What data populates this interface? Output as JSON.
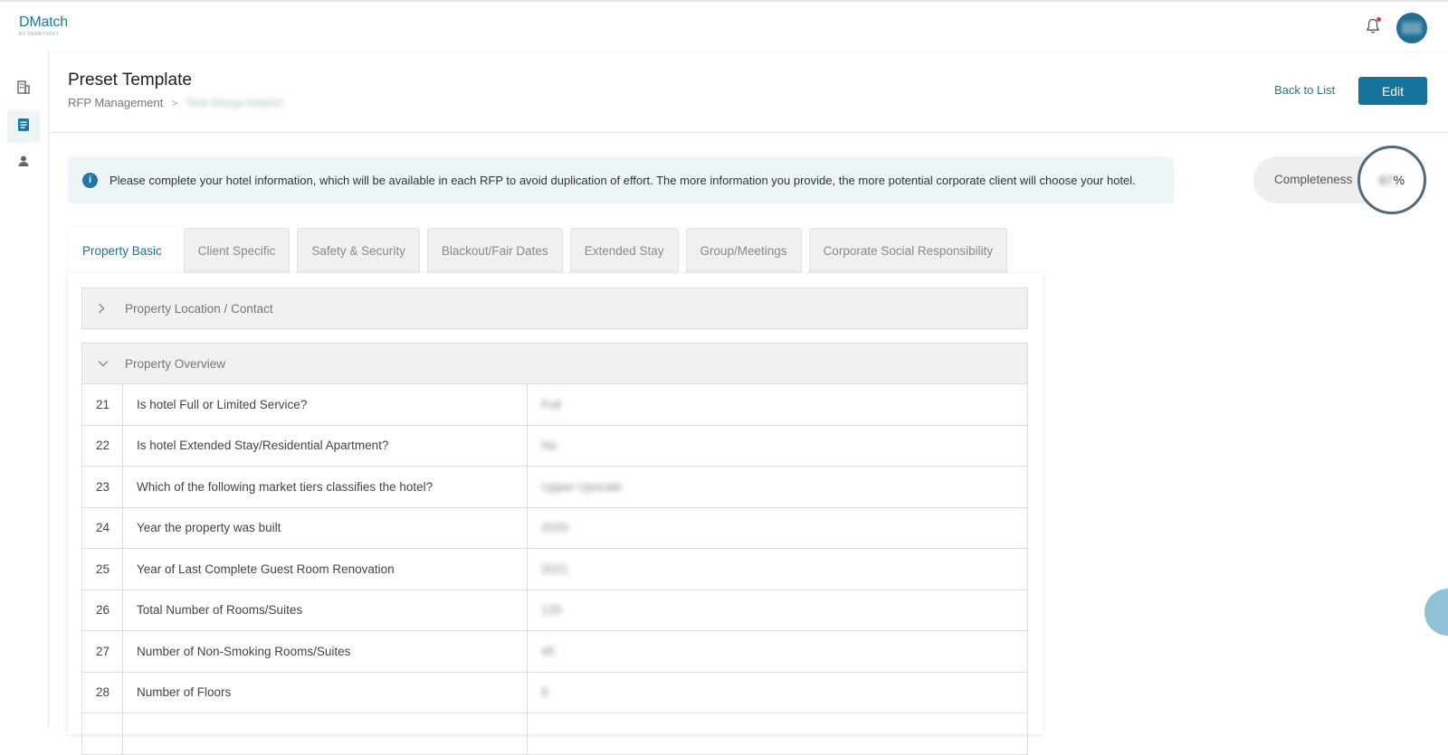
{
  "app": {
    "logo": "DMatch",
    "logo_sub": "BY DERBYSOFT"
  },
  "header": {
    "title": "Preset Template",
    "breadcrumb": [
      "RFP Management",
      "Test Group Hotels!"
    ],
    "back_label": "Back to List",
    "edit_label": "Edit"
  },
  "info": {
    "message": "Please complete your hotel information, which will be available in each RFP to avoid duplication of effort. The more information you provide, the more potential corporate client will choose your hotel."
  },
  "completeness": {
    "label": "Completeness",
    "value": "67",
    "unit": "%"
  },
  "tabs": [
    {
      "label": "Property Basic",
      "active": true
    },
    {
      "label": "Client Specific"
    },
    {
      "label": "Safety & Security"
    },
    {
      "label": "Blackout/Fair Dates"
    },
    {
      "label": "Extended Stay"
    },
    {
      "label": "Group/Meetings"
    },
    {
      "label": "Corporate Social Responsibility"
    }
  ],
  "sections": {
    "location": "Property Location / Contact",
    "overview": "Property Overview"
  },
  "rows": [
    {
      "num": "21",
      "question": "Is hotel Full or Limited Service?",
      "answer": "Full"
    },
    {
      "num": "22",
      "question": "Is hotel Extended Stay/Residential Apartment?",
      "answer": "No"
    },
    {
      "num": "23",
      "question": "Which of the following market tiers classifies the hotel?",
      "answer": "Upper Upscale"
    },
    {
      "num": "24",
      "question": "Year the property was built",
      "answer": "2020"
    },
    {
      "num": "25",
      "question": "Year of Last Complete Guest Room Renovation",
      "answer": "2021"
    },
    {
      "num": "26",
      "question": "Total Number of Rooms/Suites",
      "answer": "120"
    },
    {
      "num": "27",
      "question": "Number of Non-Smoking Rooms/Suites",
      "answer": "45"
    },
    {
      "num": "28",
      "question": "Number of Floors",
      "answer": "8"
    }
  ],
  "colors": {
    "accent": "#16739c",
    "banner": "#eef5f8",
    "notification": "#e53935"
  },
  "icons": [
    "bell-icon",
    "building-icon",
    "document-icon",
    "user-icon",
    "info-icon",
    "chevron-right-icon",
    "chevron-down-icon",
    "chat-icon"
  ]
}
